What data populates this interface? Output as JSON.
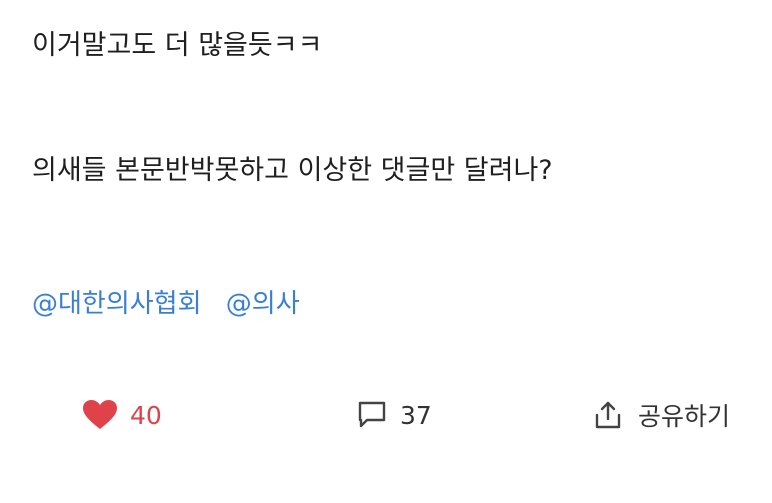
{
  "post": {
    "body_line_1": "이거말고도 더 많을듯ㅋㅋ",
    "body_line_2": "의새들 본문반박못하고 이상한 댓글만 달려나?",
    "tags": [
      "@대한의사협회",
      "@의사"
    ]
  },
  "actions": {
    "like": {
      "icon": "heart-icon",
      "count": "40",
      "color": "#e0424a"
    },
    "comment": {
      "icon": "comment-icon",
      "count": "37"
    },
    "share": {
      "icon": "share-icon",
      "label": "공유하기"
    }
  },
  "colors": {
    "tag": "#3a7fd4",
    "text": "#1f1f1f"
  }
}
